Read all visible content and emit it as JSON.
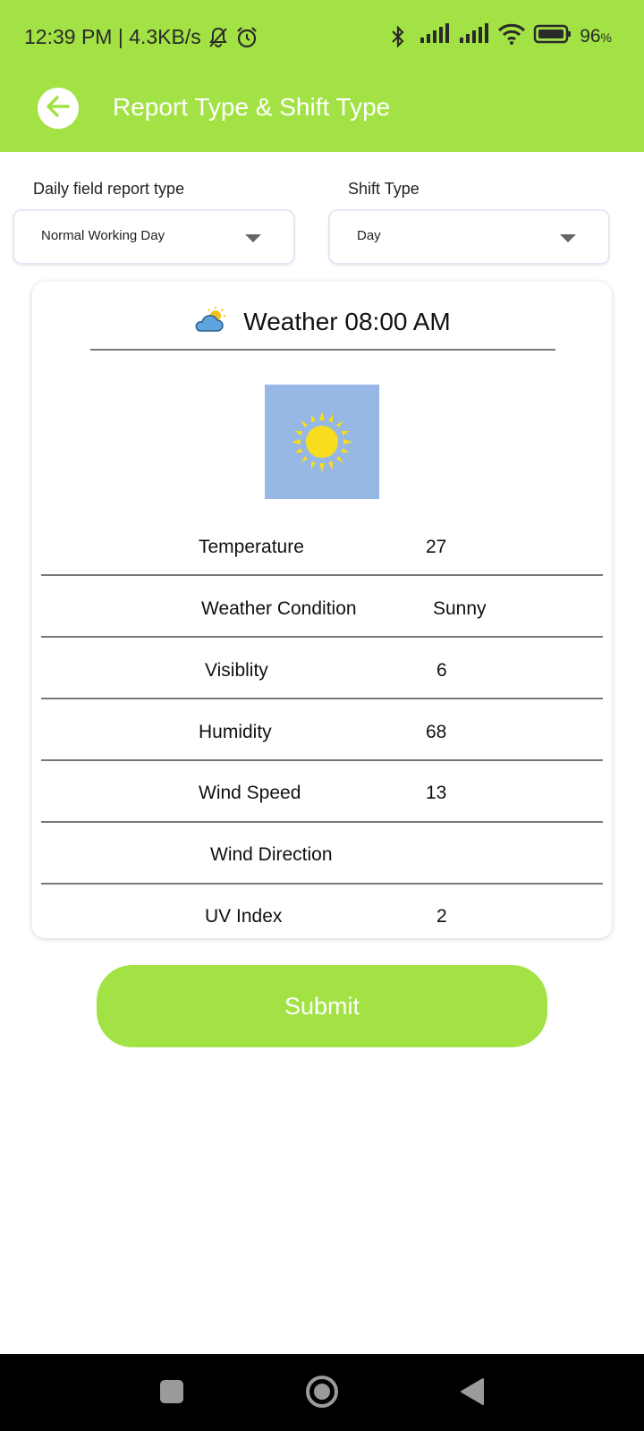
{
  "status_bar": {
    "time_speed": "12:39 PM | 4.3KB/s",
    "battery": "96",
    "battery_unit": "%"
  },
  "app_bar": {
    "title": "Report Type & Shift Type",
    "back_icon": "arrow-left-icon"
  },
  "form": {
    "report_type_label": "Daily field report type",
    "report_type_value": "Normal Working Day",
    "shift_type_label": "Shift Type",
    "shift_type_value": "Day"
  },
  "weather_card": {
    "title": "Weather 08:00 AM",
    "icon": "partly-cloudy-icon",
    "image": "sun-icon",
    "rows": [
      {
        "label": "Temperature",
        "value": "27"
      },
      {
        "label": "Weather Condition",
        "value": "Sunny"
      },
      {
        "label": "Visiblity",
        "value": "6"
      },
      {
        "label": "Humidity",
        "value": "68"
      },
      {
        "label": "Wind Speed",
        "value": "13"
      },
      {
        "label": "Wind Direction",
        "value": ""
      },
      {
        "label": "UV Index",
        "value": "2"
      }
    ]
  },
  "submit_label": "Submit",
  "colors": {
    "accent": "#a2e244",
    "image_bg": "#97b7e5",
    "sun": "#f7dd1e"
  }
}
